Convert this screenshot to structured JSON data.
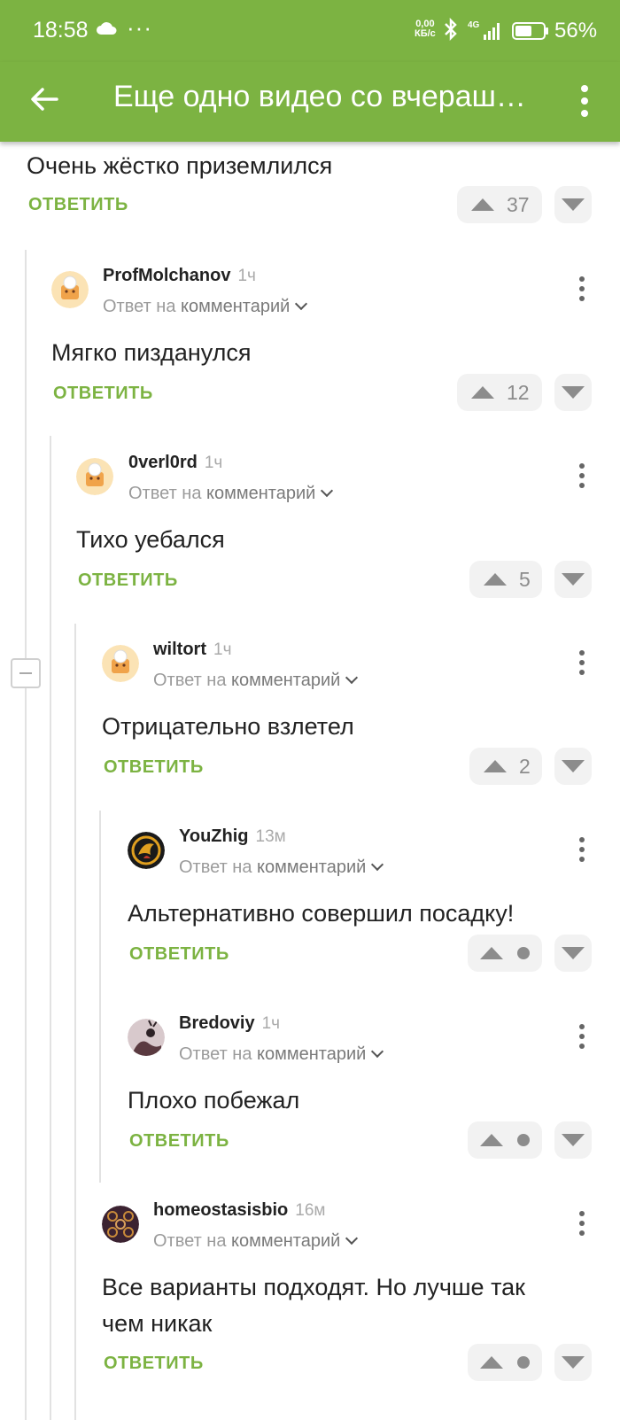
{
  "status_bar": {
    "time": "18:58",
    "dots": "···",
    "net_speed_top": "0,00",
    "net_speed_bottom": "КБ/с",
    "network": "4G",
    "battery": "56%"
  },
  "toolbar": {
    "title": "Еще одно видео со вчераш…"
  },
  "colors": {
    "accent": "#7cb342",
    "vote_bg": "#f2f2f2",
    "muted": "#9b9b9b"
  },
  "top_comment": {
    "text": "Очень жёстко приземлился",
    "reply_label": "ОТВЕТИТЬ",
    "votes": "37"
  },
  "comments": [
    {
      "author": "ProfMolchanov",
      "ago": "1ч",
      "reply_to_prefix": "Ответ на",
      "reply_to_link": "комментарий",
      "text": "Мягко пизданулся",
      "reply_label": "ОТВЕТИТЬ",
      "votes": "12",
      "avatar": "chef-avatar"
    },
    {
      "author": "0verl0rd",
      "ago": "1ч",
      "reply_to_prefix": "Ответ на",
      "reply_to_link": "комментарий",
      "text": "Тихо уебался",
      "reply_label": "ОТВЕТИТЬ",
      "votes": "5",
      "avatar": "chef-avatar"
    },
    {
      "author": "wiltort",
      "ago": "1ч",
      "reply_to_prefix": "Ответ на",
      "reply_to_link": "комментарий",
      "text": "Отрицательно взлетел",
      "reply_label": "ОТВЕТИТЬ",
      "votes": "2",
      "avatar": "chef-avatar"
    },
    {
      "author": "YouZhig",
      "ago": "13м",
      "reply_to_prefix": "Ответ на",
      "reply_to_link": "комментарий",
      "text": "Альтернативно совершил посадку!",
      "reply_label": "ОТВЕТИТЬ",
      "votes": "",
      "avatar": "dragon-logo-avatar"
    },
    {
      "author": "Bredoviy",
      "ago": "1ч",
      "reply_to_prefix": "Ответ на",
      "reply_to_link": "комментарий",
      "text": "Плохо побежал",
      "reply_label": "ОТВЕТИТЬ",
      "votes": "",
      "avatar": "photo-avatar"
    },
    {
      "author": "homeostasisbio",
      "ago": "16м",
      "reply_to_prefix": "Ответ на",
      "reply_to_link": "комментарий",
      "text_line1": "Все варианты подходят. Но лучше так",
      "text_line2": "чем никак",
      "reply_label": "ОТВЕТИТЬ",
      "votes": "",
      "avatar": "pattern-avatar"
    }
  ]
}
